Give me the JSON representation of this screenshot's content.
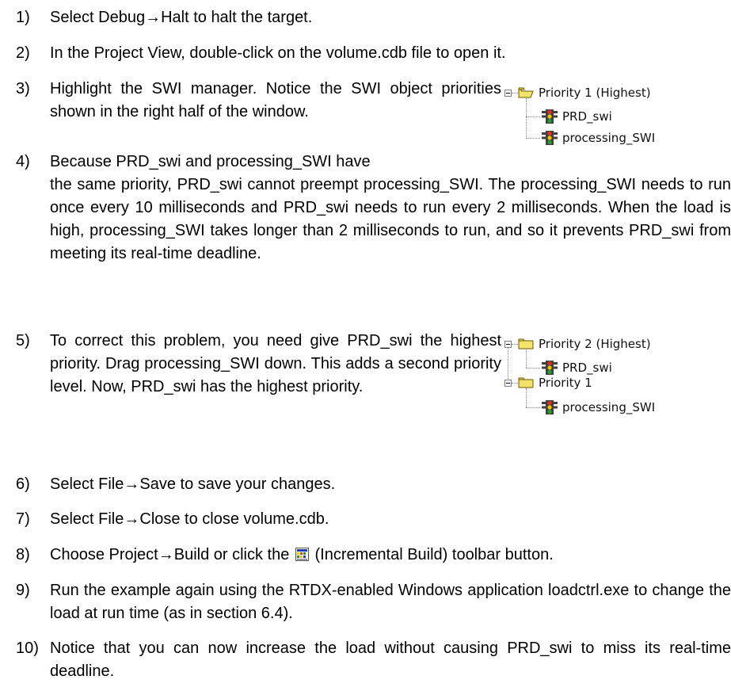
{
  "steps": [
    {
      "num": "1)",
      "text": "Select Debug→Halt to halt the target."
    },
    {
      "num": "2)",
      "text": "In the Project View, double-click on the volume.cdb file to open it."
    },
    {
      "num": "3)",
      "text": "Highlight the SWI manager. Notice the SWI object priorities shown in the right half of the window."
    },
    {
      "num": "4)",
      "text_first": "Because PRD_swi and processing_SWI have",
      "text_rest": "the same priority, PRD_swi cannot preempt processing_SWI. The processing_SWI needs to run once every 10 milliseconds and PRD_swi needs to run every 2 milliseconds. When the load is high, processing_SWI takes longer than 2 milliseconds to run, and so it prevents PRD_swi from meeting its real-time deadline."
    },
    {
      "num": "5)",
      "text": "To correct this problem, you need give PRD_swi the highest priority. Drag processing_SWI down. This adds a second priority level. Now, PRD_swi has the highest priority."
    },
    {
      "num": "6)",
      "text": "Select File→Save to save your changes."
    },
    {
      "num": "7)",
      "text": "Select File→Close to close volume.cdb."
    },
    {
      "num": "8)",
      "text_before": "Choose Project→Build or click the",
      "text_after": "(Incremental Build) toolbar button."
    },
    {
      "num": "9)",
      "text": "Run the example again using the RTDX-enabled Windows application loadctrl.exe to change the load at run time (as in section 6.4)."
    },
    {
      "num": "10)",
      "text": "Notice that you can now increase the load without causing PRD_swi to miss its real-time deadline."
    }
  ],
  "tree1": {
    "folder": "Priority 1 (Highest)",
    "items": [
      "PRD_swi",
      "processing_SWI"
    ]
  },
  "tree2": {
    "folder1": "Priority 2 (Highest)",
    "items1": [
      "PRD_swi"
    ],
    "folder2": "Priority 1",
    "items2": [
      "processing_SWI"
    ]
  },
  "icons": {
    "folder_open": "folder-open-icon",
    "folder": "folder-icon",
    "swi": "swi-traffic-light-icon",
    "build": "incremental-build-icon"
  }
}
